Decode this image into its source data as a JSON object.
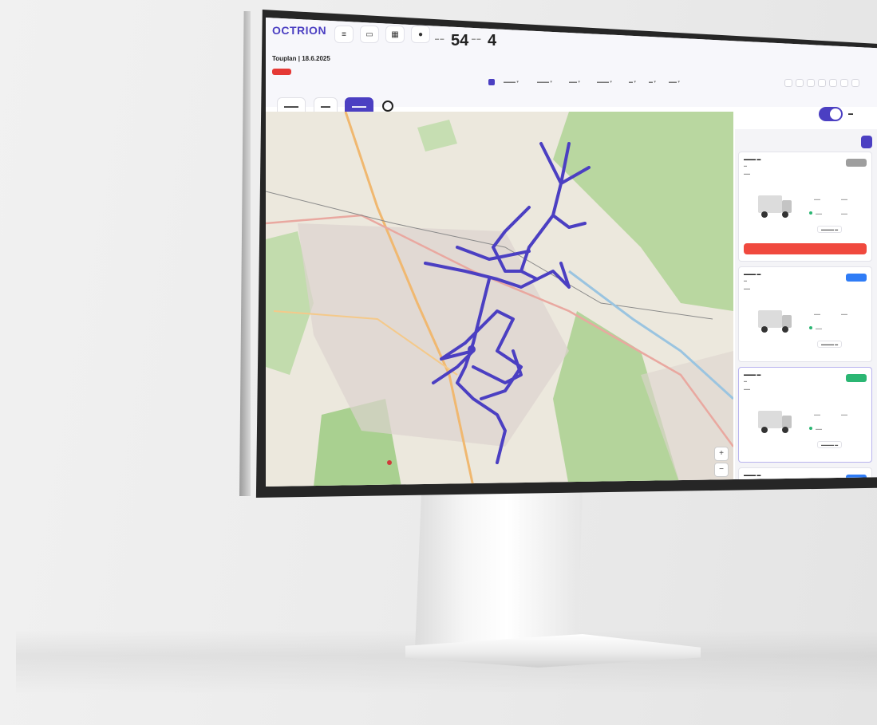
{
  "header": {
    "logo": "OCTRION",
    "stat_1_value": "54",
    "stat_2_value": "4",
    "subtitle": "Touplan | 18.6.2025"
  },
  "tabs": [
    "",
    "",
    ""
  ],
  "map": {
    "route_color": "#4b3fc2",
    "zoom_in": "+",
    "zoom_out": "−"
  },
  "vehicles": [
    {
      "status_color": "#9e9e9e",
      "alert_color": "#f0493e"
    },
    {
      "status_color": "#2f7cf6"
    },
    {
      "status_color": "#2bb673"
    },
    {
      "status_color": "#2f7cf6"
    }
  ],
  "colors": {
    "accent": "#4b3fc2",
    "danger": "#e53935",
    "success": "#2bb673",
    "info": "#2f7cf6"
  }
}
